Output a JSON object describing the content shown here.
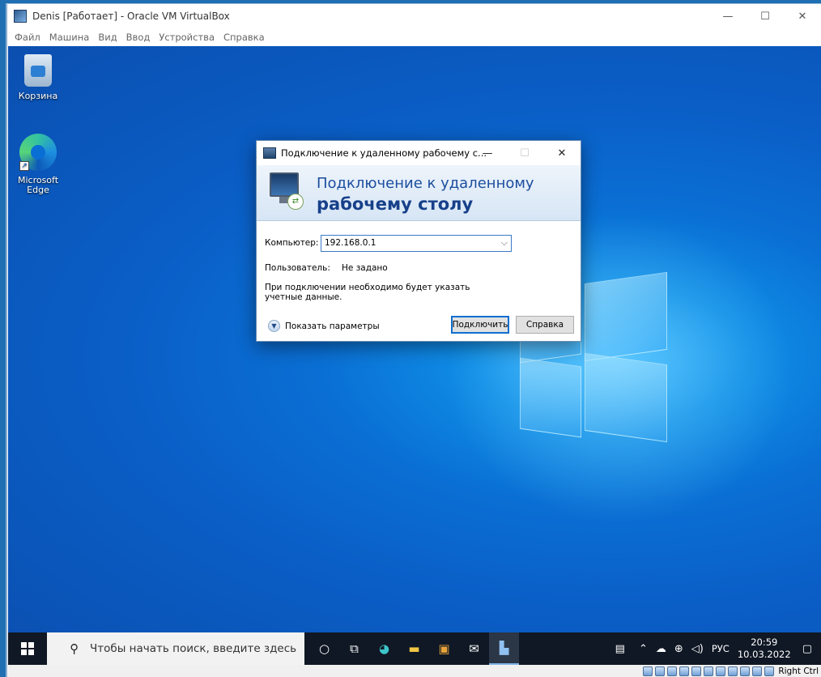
{
  "vm_window": {
    "title": "Denis [Работает] - Oracle VM VirtualBox",
    "minimize": "—",
    "maximize": "☐",
    "close": "✕"
  },
  "menu": [
    "Файл",
    "Машина",
    "Вид",
    "Ввод",
    "Устройства",
    "Справка"
  ],
  "desktop": {
    "icons": [
      {
        "label": "Корзина",
        "icon": "recycle-bin-icon"
      },
      {
        "label": "Microsoft Edge",
        "icon": "edge-icon"
      }
    ]
  },
  "dialog": {
    "title": "Подключение к удаленному рабочему с...",
    "minimize": "—",
    "maximize": "☐",
    "close": "✕",
    "banner_line1": "Подключение к удаленному",
    "banner_line2": "рабочему столу",
    "computer_label": "Компьютер:",
    "computer_value": "192.168.0.1",
    "user_label": "Пользователь:",
    "user_value": "Не задано",
    "info_text": "При подключении необходимо будет указать учетные данные.",
    "show_params": "Показать параметры",
    "connect_button": "Подключить",
    "help_button": "Справка"
  },
  "taskbar": {
    "search_placeholder": "Чтобы начать поиск, введите здесь",
    "language": "РУС",
    "time": "20:59",
    "date": "10.03.2022"
  },
  "statusbar": {
    "host_key": "Right Ctrl"
  },
  "colors": {
    "desktop_blue": "#0a6fd4",
    "taskbar": "#101825",
    "banner_text": "#1b4e9e"
  }
}
